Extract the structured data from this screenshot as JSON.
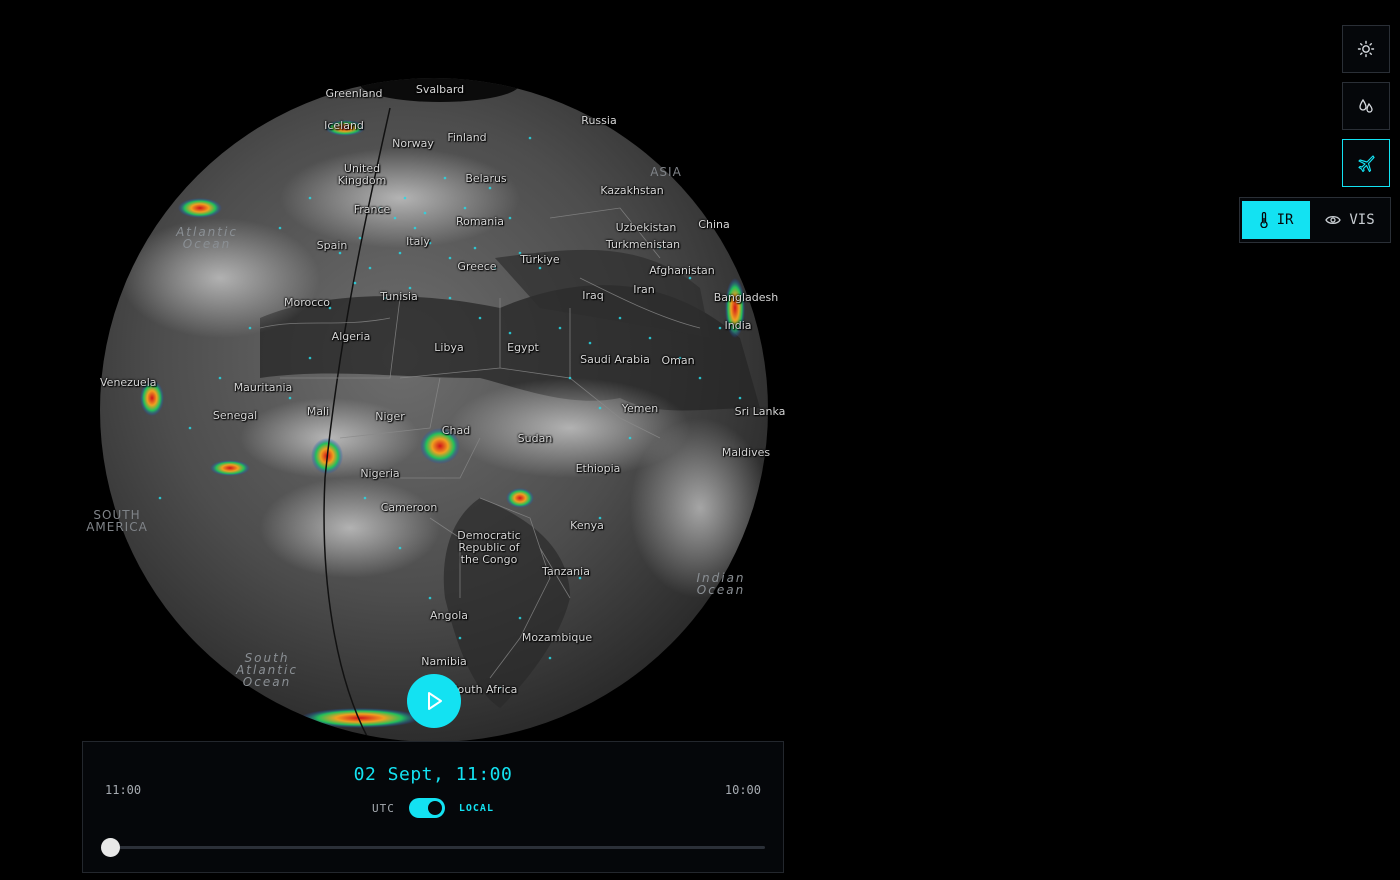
{
  "map": {
    "labels": [
      {
        "key": "greenland",
        "text": "Greenland"
      },
      {
        "key": "svalbard",
        "text": "Svalbard"
      },
      {
        "key": "iceland",
        "text": "Iceland"
      },
      {
        "key": "russia",
        "text": "Russia"
      },
      {
        "key": "norway",
        "text": "Norway"
      },
      {
        "key": "finland",
        "text": "Finland"
      },
      {
        "key": "uk",
        "text": "United\nKingdom"
      },
      {
        "key": "asia",
        "text": "ASIA"
      },
      {
        "key": "belarus",
        "text": "Belarus"
      },
      {
        "key": "kazakhstan",
        "text": "Kazakhstan"
      },
      {
        "key": "france",
        "text": "France"
      },
      {
        "key": "romania",
        "text": "Romania"
      },
      {
        "key": "uzbekistan",
        "text": "Uzbekistan"
      },
      {
        "key": "china",
        "text": "China"
      },
      {
        "key": "spain",
        "text": "Spain"
      },
      {
        "key": "italy",
        "text": "Italy"
      },
      {
        "key": "turkmenistan",
        "text": "Turkmenistan"
      },
      {
        "key": "greece",
        "text": "Greece"
      },
      {
        "key": "turkiye",
        "text": "Türkiye"
      },
      {
        "key": "afghanistan",
        "text": "Afghanistan"
      },
      {
        "key": "tunisia",
        "text": "Tunisia"
      },
      {
        "key": "iraq",
        "text": "Iraq"
      },
      {
        "key": "iran",
        "text": "Iran"
      },
      {
        "key": "bangladesh",
        "text": "Bangladesh"
      },
      {
        "key": "morocco",
        "text": "Morocco"
      },
      {
        "key": "india",
        "text": "India"
      },
      {
        "key": "algeria",
        "text": "Algeria"
      },
      {
        "key": "libya",
        "text": "Libya"
      },
      {
        "key": "egypt",
        "text": "Egypt"
      },
      {
        "key": "saudi",
        "text": "Saudi Arabia"
      },
      {
        "key": "oman",
        "text": "Oman"
      },
      {
        "key": "venezuela",
        "text": "Venezuela"
      },
      {
        "key": "mauritania",
        "text": "Mauritania"
      },
      {
        "key": "yemen",
        "text": "Yemen"
      },
      {
        "key": "srilanka",
        "text": "Sri Lanka"
      },
      {
        "key": "senegal",
        "text": "Senegal"
      },
      {
        "key": "mali",
        "text": "Mali"
      },
      {
        "key": "niger",
        "text": "Niger"
      },
      {
        "key": "chad",
        "text": "Chad"
      },
      {
        "key": "sudan",
        "text": "Sudan"
      },
      {
        "key": "maldives",
        "text": "Maldives"
      },
      {
        "key": "ethiopia",
        "text": "Ethiopia"
      },
      {
        "key": "nigeria",
        "text": "Nigeria"
      },
      {
        "key": "cameroon",
        "text": "Cameroon"
      },
      {
        "key": "southamerica",
        "text": "SOUTH\nAMERICA"
      },
      {
        "key": "kenya",
        "text": "Kenya"
      },
      {
        "key": "drc",
        "text": "Democratic\nRepublic of\nthe Congo"
      },
      {
        "key": "tanzania",
        "text": "Tanzania"
      },
      {
        "key": "indianocean",
        "text": "Indian\nOcean"
      },
      {
        "key": "angola",
        "text": "Angola"
      },
      {
        "key": "mozambique",
        "text": "Mozambique"
      },
      {
        "key": "southatlantic",
        "text": "South\nAtlantic\nOcean"
      },
      {
        "key": "namibia",
        "text": "Namibia"
      },
      {
        "key": "southafrica",
        "text": "South Africa"
      },
      {
        "key": "atlantic",
        "text": "Atlantic\nOcean"
      }
    ]
  },
  "player": {
    "play_icon": "play-icon"
  },
  "timeline": {
    "start_time": "11:00",
    "end_time": "10:00",
    "current": "02 Sept, 11:00",
    "zone_left": "UTC",
    "zone_right": "LOCAL",
    "toggle_on": true,
    "position": 0
  },
  "tools": {
    "items": [
      {
        "name": "sun-icon"
      },
      {
        "name": "drops-icon"
      },
      {
        "name": "plane-icon",
        "active": true
      }
    ],
    "bands": {
      "ir_label": "IR",
      "vis_label": "VIS",
      "active": "IR"
    }
  },
  "colors": {
    "accent": "#13e2f2",
    "panel": "#05070a",
    "background": "#000000"
  }
}
